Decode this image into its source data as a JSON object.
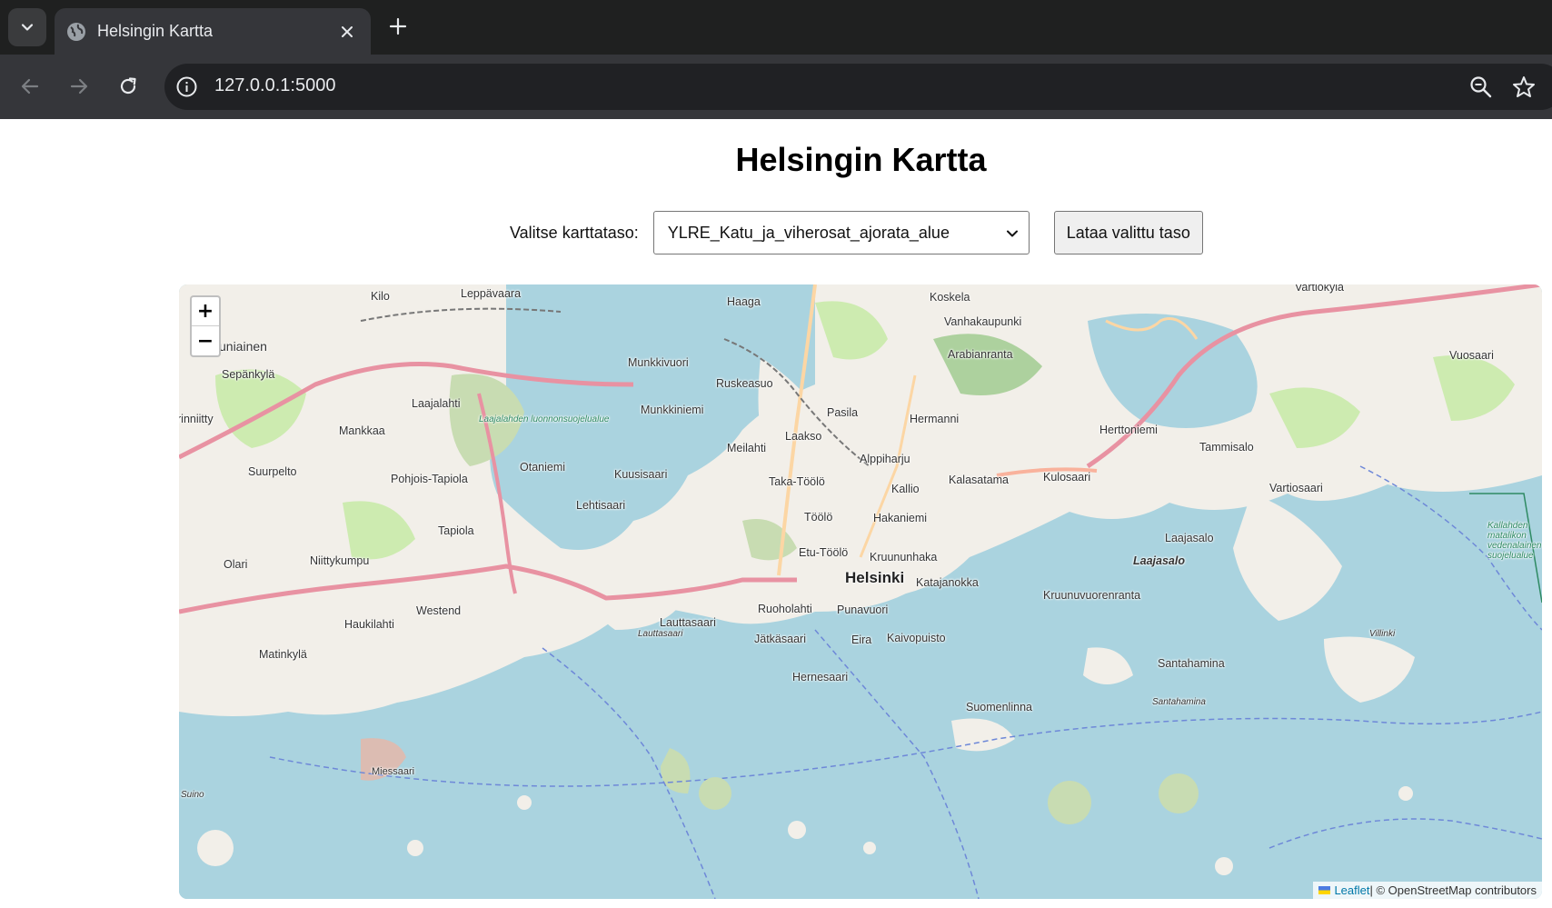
{
  "browser": {
    "tab_title": "Helsingin Kartta",
    "url": "127.0.0.1:5000"
  },
  "page": {
    "title": "Helsingin Kartta",
    "layer_label": "Valitse karttataso:",
    "layer_selected": "YLRE_Katu_ja_viherosat_ajorata_alue",
    "load_button": "Lataa valittu taso"
  },
  "map": {
    "zoom_in": "+",
    "zoom_out": "−",
    "attribution_leaflet": "Leaflet",
    "attribution_osm": " | © OpenStreetMap contributors",
    "places": [
      {
        "name": "Kilo"
      },
      {
        "name": "Leppävaara"
      },
      {
        "name": "Haaga"
      },
      {
        "name": "Koskela"
      },
      {
        "name": "Vartiokylä"
      },
      {
        "name": "Vanhakaupunki"
      },
      {
        "name": "uniainen"
      },
      {
        "name": "Arabianranta"
      },
      {
        "name": "Vuosaari"
      },
      {
        "name": "Munkkivuori"
      },
      {
        "name": "Sepänkylä"
      },
      {
        "name": "Ruskeasuo"
      },
      {
        "name": "Laajalahti"
      },
      {
        "name": "Munkkiniemi"
      },
      {
        "name": "Pasila"
      },
      {
        "name": "Hermanni"
      },
      {
        "name": "rinniitty"
      },
      {
        "name": "Mankkaa"
      },
      {
        "name": "Laakso"
      },
      {
        "name": "Herttoniemi"
      },
      {
        "name": "Meilahti"
      },
      {
        "name": "Tammisalo"
      },
      {
        "name": "Alppiharju"
      },
      {
        "name": "Suurpelto"
      },
      {
        "name": "Otaniemi"
      },
      {
        "name": "Kuusisaari"
      },
      {
        "name": "Pohjois-Tapiola"
      },
      {
        "name": "Kalasatama"
      },
      {
        "name": "Kulosaari"
      },
      {
        "name": "Taka-Töölö"
      },
      {
        "name": "Kallio"
      },
      {
        "name": "Vartiosaari"
      },
      {
        "name": "Lehtisaari"
      },
      {
        "name": "Töölö"
      },
      {
        "name": "Hakaniemi"
      },
      {
        "name": "Tapiola"
      },
      {
        "name": "Laajasalo"
      },
      {
        "name": "Etu-Töölö"
      },
      {
        "name": "Niittykumpu"
      },
      {
        "name": "Kruununhaka"
      },
      {
        "name": "Olari"
      },
      {
        "name": "Laajasalo"
      },
      {
        "name": "Helsinki"
      },
      {
        "name": "Katajanokka"
      },
      {
        "name": "Kruunuvuorenranta"
      },
      {
        "name": "Westend"
      },
      {
        "name": "Ruoholahti"
      },
      {
        "name": "Punavuori"
      },
      {
        "name": "Lauttasaari"
      },
      {
        "name": "Haukilahti"
      },
      {
        "name": "Lauttasaari"
      },
      {
        "name": "Villinki"
      },
      {
        "name": "Jätkäsaari"
      },
      {
        "name": "Eira"
      },
      {
        "name": "Kaivopuisto"
      },
      {
        "name": "Matinkylä"
      },
      {
        "name": "Santahamina"
      },
      {
        "name": "Hernesaari"
      },
      {
        "name": "Santahamina"
      },
      {
        "name": "Suomenlinna"
      },
      {
        "name": "Miessaari"
      },
      {
        "name": "Suino"
      }
    ],
    "park_labels": [
      {
        "name": "Laajalahden luonnonsuojelualue"
      },
      {
        "name": "Kallahden matalikon vedenalainen suojelualue"
      }
    ]
  }
}
